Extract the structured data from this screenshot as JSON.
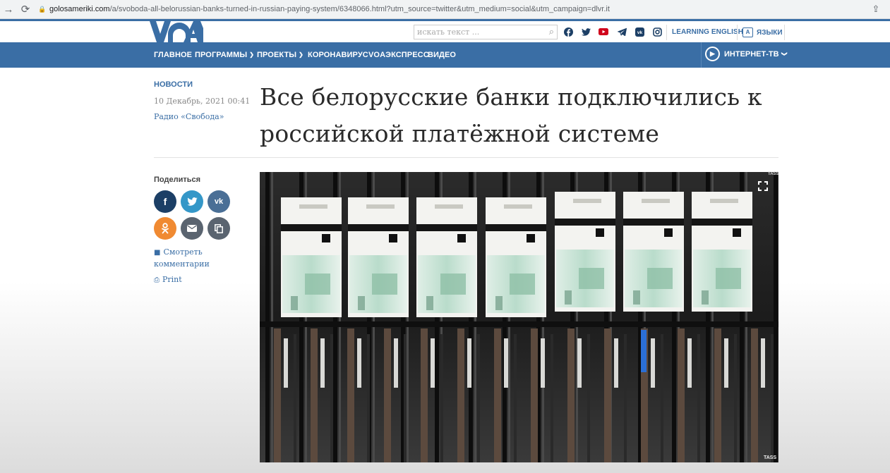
{
  "browser": {
    "url_domain": "golosameriki.com",
    "url_path": "/a/svoboda-all-belorussian-banks-turned-in-russian-paying-system/6348066.html?utm_source=twitter&utm_medium=social&utm_campaign=dlvr.it"
  },
  "header": {
    "logo_text": "VOA",
    "search_placeholder": "искать текст ...",
    "learning_english": "LEARNING ENGLISH",
    "languages": "ЯЗЫКИ",
    "social_icons": [
      "facebook-icon",
      "twitter-icon",
      "youtube-icon",
      "telegram-icon",
      "vk-icon",
      "instagram-icon"
    ]
  },
  "nav": {
    "items": [
      {
        "label": "ГЛАВНОЕ",
        "dropdown": false
      },
      {
        "label": "ПРОГРАММЫ",
        "dropdown": true
      },
      {
        "label": "ПРОЕКТЫ",
        "dropdown": true
      },
      {
        "label": "КОРОНАВИРУС",
        "dropdown": false
      },
      {
        "label": "VOAЭКСПРЕСС",
        "dropdown": false
      },
      {
        "label": "ВИДЕО",
        "dropdown": false
      }
    ],
    "tv_label": "ИНТЕРНЕТ-ТВ"
  },
  "article": {
    "section": "НОВОСТИ",
    "date": "10 Декабрь, 2021 00:41",
    "source": "Радио «Свобода»",
    "headline_line1": "Все белорусские банки подключились к",
    "headline_line2": "российской платёжной системе",
    "image_credit": "TASS"
  },
  "sidebar": {
    "share_label": "Поделиться",
    "comments_line1": "Смотреть",
    "comments_line2": "комментарии",
    "print": "Print"
  },
  "colors": {
    "brand_blue": "#3a6ea5",
    "facebook": "#1c3f66",
    "twitter": "#3497c8",
    "vk": "#4a6f96",
    "ok": "#f08a32",
    "email": "#5a6470",
    "copy": "#5a6470"
  }
}
